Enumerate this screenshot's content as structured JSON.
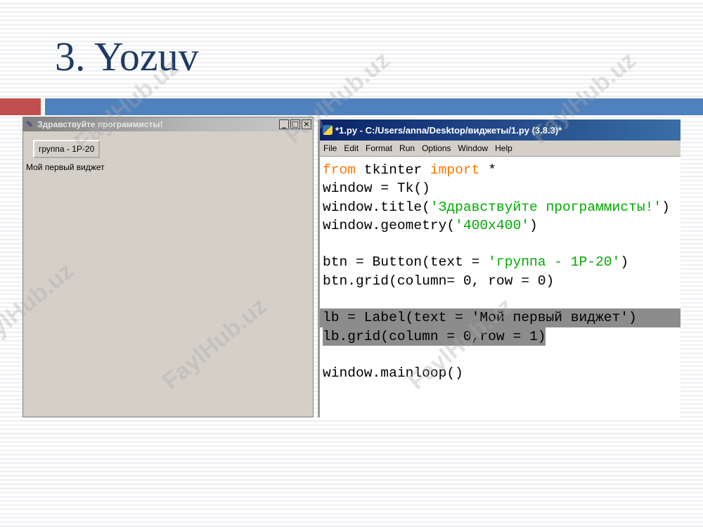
{
  "slide": {
    "title": "3. Yozuv"
  },
  "tk_window": {
    "title": "Здравствуйте программисты!",
    "minimize_glyph": "_",
    "maximize_glyph": "□",
    "close_glyph": "×",
    "button_label": "группа - 1Р-20",
    "label_text": "Мой первый виджет"
  },
  "idle": {
    "title": "*1.py - C:/Users/anna/Desktop/виджеты/1.py (3.8.3)*",
    "menu": [
      "File",
      "Edit",
      "Format",
      "Run",
      "Options",
      "Window",
      "Help"
    ],
    "code": {
      "l1_kw1": "from",
      "l1_mid": " tkinter ",
      "l1_kw2": "import",
      "l1_end": " *",
      "l2": "window = Tk()",
      "l3_pre": "window.title(",
      "l3_str": "'Здравствуйте программисты!'",
      "l3_post": ")",
      "l4_pre": "window.geometry(",
      "l4_str": "'400x400'",
      "l4_post": ")",
      "l6_pre": "btn = Button(text = ",
      "l6_str": "'группа - 1Р-20'",
      "l6_post": ")",
      "l7": "btn.grid(column= 0, row = 0)",
      "l9": "lb = Label(text = 'Мой первый виджет')",
      "l10": "lb.grid(column = 0,row = 1)",
      "l12": "window.mainloop()"
    },
    "colors": {
      "keyword": "#ff7700",
      "string": "#00aa00",
      "selection": "#8c8c8c"
    }
  },
  "watermark": "FaylHub.uz"
}
